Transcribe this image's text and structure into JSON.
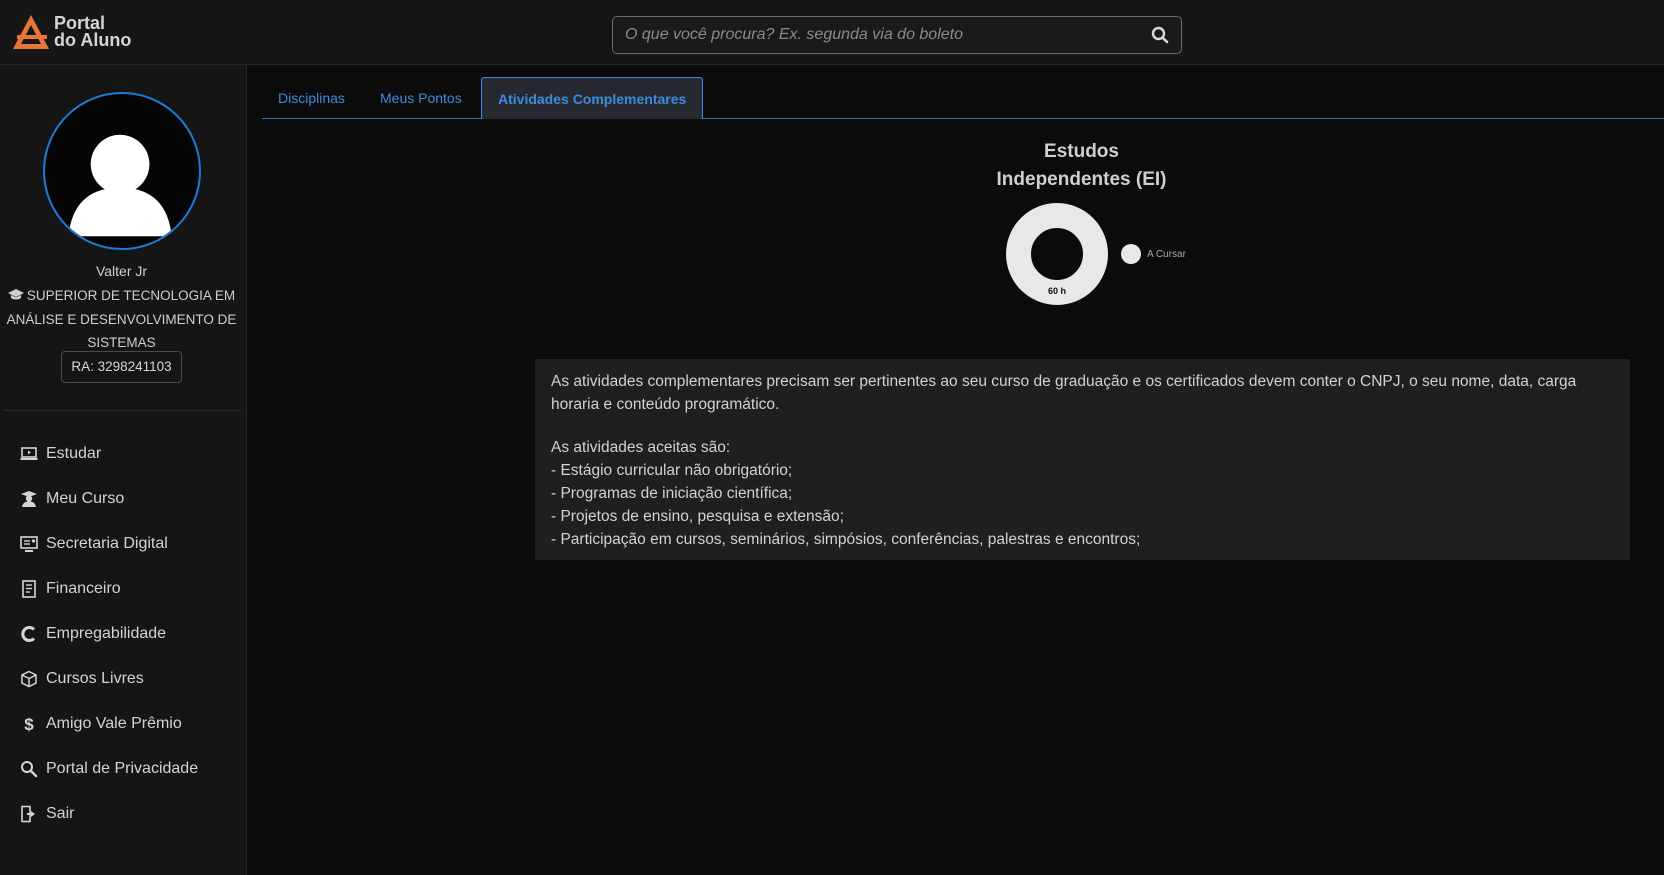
{
  "header": {
    "logo_line1": "Portal",
    "logo_line2": "do Aluno",
    "search_placeholder": "O que você procura? Ex. segunda via do boleto",
    "colors": {
      "logo_orange": "#e8763a",
      "accent_blue": "#3d8be0"
    }
  },
  "profile": {
    "name": "Valter Jr",
    "course": "SUPERIOR DE TECNOLOGIA EM ANÁLISE E DESENVOLVIMENTO DE SISTEMAS",
    "ra": "RA: 3298241103"
  },
  "sidebar": {
    "items": [
      {
        "label": "Estudar",
        "icon": "laptop-play-icon"
      },
      {
        "label": "Meu Curso",
        "icon": "student-icon"
      },
      {
        "label": "Secretaria Digital",
        "icon": "desktop-user-icon"
      },
      {
        "label": "Financeiro",
        "icon": "document-icon"
      },
      {
        "label": "Empregabilidade",
        "icon": "c-logo-icon"
      },
      {
        "label": "Cursos Livres",
        "icon": "cube-icon"
      },
      {
        "label": "Amigo Vale Prêmio",
        "icon": "dollar-icon"
      },
      {
        "label": "Portal de Privacidade",
        "icon": "magnifier-icon"
      },
      {
        "label": "Sair",
        "icon": "exit-door-icon"
      }
    ]
  },
  "tabs": [
    {
      "label": "Disciplinas",
      "active": false
    },
    {
      "label": "Meus Pontos",
      "active": false
    },
    {
      "label": "Atividades Complementares",
      "active": true
    }
  ],
  "chart_data": {
    "type": "pie",
    "title_line1": "Estudos",
    "title_line2": "Independentes (EI)",
    "slices": [
      {
        "label": "A Cursar",
        "value": 60,
        "color": "#e8e8e8"
      }
    ],
    "center_label": "60 h",
    "legend": "right"
  },
  "info": {
    "paragraph1": "As atividades complementares precisam ser pertinentes ao seu curso de graduação e os certificados devem conter o CNPJ, o seu nome, data, carga horaria e conteúdo programático.",
    "list_intro": "As atividades aceitas são:",
    "list": [
      "- Estágio curricular não obrigatório;",
      "- Programas de iniciação científica;",
      "- Projetos de ensino, pesquisa e extensão;",
      "- Participação em cursos, seminários, simpósios, conferências, palestras e encontros;"
    ]
  }
}
